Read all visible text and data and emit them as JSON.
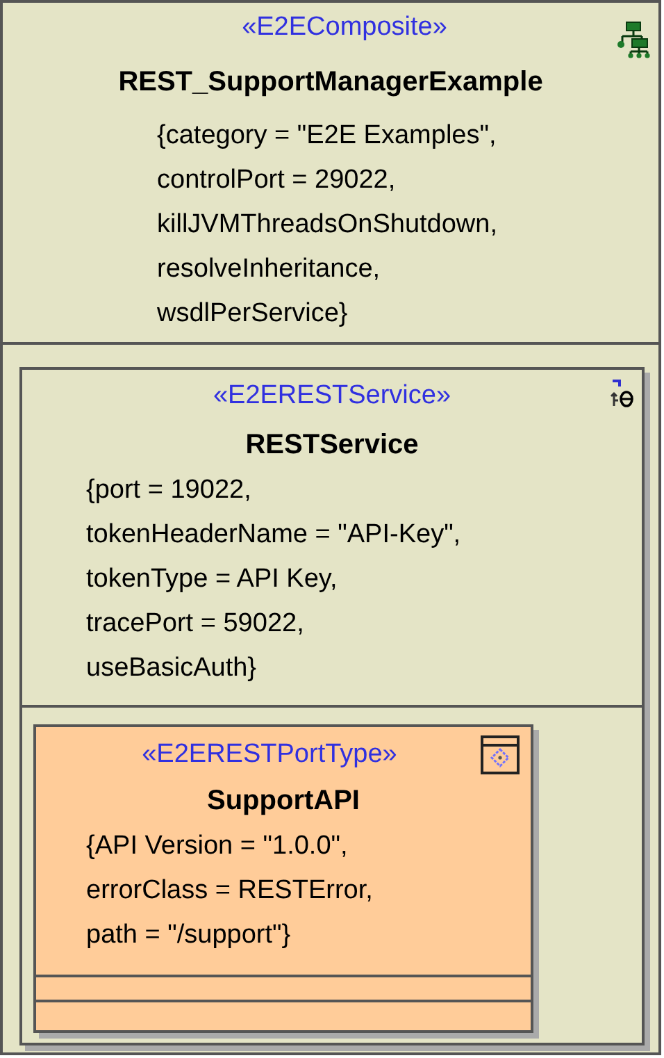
{
  "composite": {
    "stereotype": "«E2EComposite»",
    "name": "REST_SupportManagerExample",
    "properties": [
      "{category = \"E2E Examples\",",
      "controlPort = 29022,",
      "killJVMThreadsOnShutdown,",
      "resolveInheritance,",
      "wsdlPerService}"
    ]
  },
  "service": {
    "stereotype": "«E2ERESTService»",
    "name": "RESTService",
    "properties": [
      "{port = 19022,",
      "tokenHeaderName = \"API-Key\",",
      "tokenType = API Key,",
      "tracePort = 59022,",
      "useBasicAuth}"
    ]
  },
  "port_type": {
    "stereotype": "«E2ERESTPortType»",
    "name": "SupportAPI",
    "properties": [
      "{API Version = \"1.0.0\",",
      "errorClass = RESTError,",
      "path = \"/support\"}"
    ]
  }
}
